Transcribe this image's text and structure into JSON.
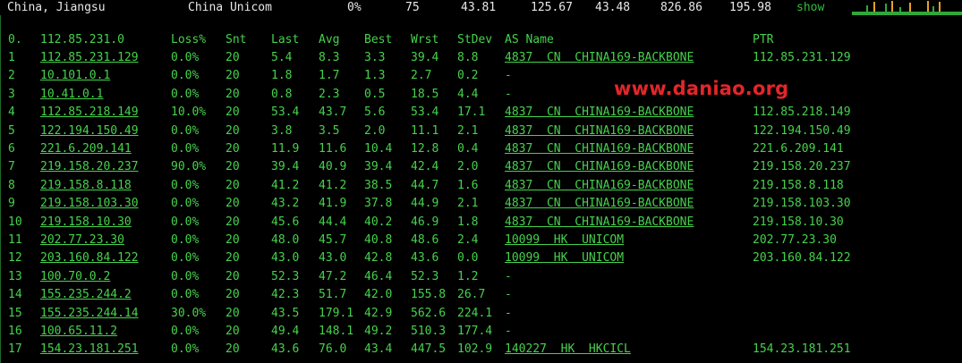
{
  "header": {
    "location": "China, Jiangsu",
    "isp": "China Unicom",
    "loss": "0%",
    "snt": "75",
    "last": "43.81",
    "avg": "125.67",
    "best": "43.48",
    "wrst": "826.86",
    "stdev": "195.98",
    "show": "show"
  },
  "columns": {
    "num": "0.",
    "host": "112.85.231.0",
    "loss": "Loss%",
    "snt": "Snt",
    "last": "Last",
    "avg": "Avg",
    "best": "Best",
    "wrst": "Wrst",
    "stdev": "StDev",
    "as": "AS Name",
    "ptr": "PTR"
  },
  "rows": [
    {
      "n": "1",
      "host": "112.85.231.129",
      "loss": "0.0%",
      "snt": "20",
      "last": "5.4",
      "avg": "8.3",
      "best": "3.3",
      "wrst": "39.4",
      "stdev": "8.8",
      "as": "4837  CN  CHINA169-BACKBONE",
      "ptr": "112.85.231.129"
    },
    {
      "n": "2",
      "host": "10.101.0.1",
      "loss": "0.0%",
      "snt": "20",
      "last": "1.8",
      "avg": "1.7",
      "best": "1.3",
      "wrst": "2.7",
      "stdev": "0.2",
      "as": "-",
      "ptr": ""
    },
    {
      "n": "3",
      "host": "10.41.0.1",
      "loss": "0.0%",
      "snt": "20",
      "last": "0.8",
      "avg": "2.3",
      "best": "0.5",
      "wrst": "18.5",
      "stdev": "4.4",
      "as": "-",
      "ptr": ""
    },
    {
      "n": "4",
      "host": "112.85.218.149",
      "loss": "10.0%",
      "snt": "20",
      "last": "53.4",
      "avg": "43.7",
      "best": "5.6",
      "wrst": "53.4",
      "stdev": "17.1",
      "as": "4837  CN  CHINA169-BACKBONE",
      "ptr": "112.85.218.149"
    },
    {
      "n": "5",
      "host": "122.194.150.49",
      "loss": "0.0%",
      "snt": "20",
      "last": "3.8",
      "avg": "3.5",
      "best": "2.0",
      "wrst": "11.1",
      "stdev": "2.1",
      "as": "4837  CN  CHINA169-BACKBONE",
      "ptr": "122.194.150.49"
    },
    {
      "n": "6",
      "host": "221.6.209.141",
      "loss": "0.0%",
      "snt": "20",
      "last": "11.9",
      "avg": "11.6",
      "best": "10.4",
      "wrst": "12.8",
      "stdev": "0.4",
      "as": "4837  CN  CHINA169-BACKBONE",
      "ptr": "221.6.209.141"
    },
    {
      "n": "7",
      "host": "219.158.20.237",
      "loss": "90.0%",
      "snt": "20",
      "last": "39.4",
      "avg": "40.9",
      "best": "39.4",
      "wrst": "42.4",
      "stdev": "2.0",
      "as": "4837  CN  CHINA169-BACKBONE",
      "ptr": "219.158.20.237"
    },
    {
      "n": "8",
      "host": "219.158.8.118",
      "loss": "0.0%",
      "snt": "20",
      "last": "41.2",
      "avg": "41.2",
      "best": "38.5",
      "wrst": "44.7",
      "stdev": "1.6",
      "as": "4837  CN  CHINA169-BACKBONE",
      "ptr": "219.158.8.118"
    },
    {
      "n": "9",
      "host": "219.158.103.30",
      "loss": "0.0%",
      "snt": "20",
      "last": "43.2",
      "avg": "41.9",
      "best": "37.8",
      "wrst": "44.9",
      "stdev": "2.1",
      "as": "4837  CN  CHINA169-BACKBONE",
      "ptr": "219.158.103.30"
    },
    {
      "n": "10",
      "host": "219.158.10.30",
      "loss": "0.0%",
      "snt": "20",
      "last": "45.6",
      "avg": "44.4",
      "best": "40.2",
      "wrst": "46.9",
      "stdev": "1.8",
      "as": "4837  CN  CHINA169-BACKBONE",
      "ptr": "219.158.10.30"
    },
    {
      "n": "11",
      "host": "202.77.23.30",
      "loss": "0.0%",
      "snt": "20",
      "last": "48.0",
      "avg": "45.7",
      "best": "40.8",
      "wrst": "48.6",
      "stdev": "2.4",
      "as": "10099  HK  UNICOM",
      "ptr": "202.77.23.30"
    },
    {
      "n": "12",
      "host": "203.160.84.122",
      "loss": "0.0%",
      "snt": "20",
      "last": "43.0",
      "avg": "43.0",
      "best": "42.8",
      "wrst": "43.6",
      "stdev": "0.0",
      "as": "10099  HK  UNICOM",
      "ptr": "203.160.84.122"
    },
    {
      "n": "13",
      "host": "100.70.0.2",
      "loss": "0.0%",
      "snt": "20",
      "last": "52.3",
      "avg": "47.2",
      "best": "46.4",
      "wrst": "52.3",
      "stdev": "1.2",
      "as": "-",
      "ptr": ""
    },
    {
      "n": "14",
      "host": "155.235.244.2",
      "loss": "0.0%",
      "snt": "20",
      "last": "42.3",
      "avg": "51.7",
      "best": "42.0",
      "wrst": "155.8",
      "stdev": "26.7",
      "as": "-",
      "ptr": ""
    },
    {
      "n": "15",
      "host": "155.235.244.14",
      "loss": "30.0%",
      "snt": "20",
      "last": "43.5",
      "avg": "179.1",
      "best": "42.9",
      "wrst": "562.6",
      "stdev": "224.1",
      "as": "-",
      "ptr": ""
    },
    {
      "n": "16",
      "host": "100.65.11.2",
      "loss": "0.0%",
      "snt": "20",
      "last": "49.4",
      "avg": "148.1",
      "best": "49.2",
      "wrst": "510.3",
      "stdev": "177.4",
      "as": "-",
      "ptr": ""
    },
    {
      "n": "17",
      "host": "154.23.181.251",
      "loss": "0.0%",
      "snt": "20",
      "last": "43.6",
      "avg": "76.0",
      "best": "43.4",
      "wrst": "447.5",
      "stdev": "102.9",
      "as": "140227  HK  HKCICL",
      "ptr": "154.23.181.251"
    }
  ],
  "watermark": "www.daniao.org",
  "colors": {
    "background": "#000000",
    "text_green": "#46d24c",
    "header_text": "#e8e8e8",
    "watermark": "#e3262b",
    "spark_green": "#2fa83a",
    "spark_orange": "#e6a028"
  }
}
